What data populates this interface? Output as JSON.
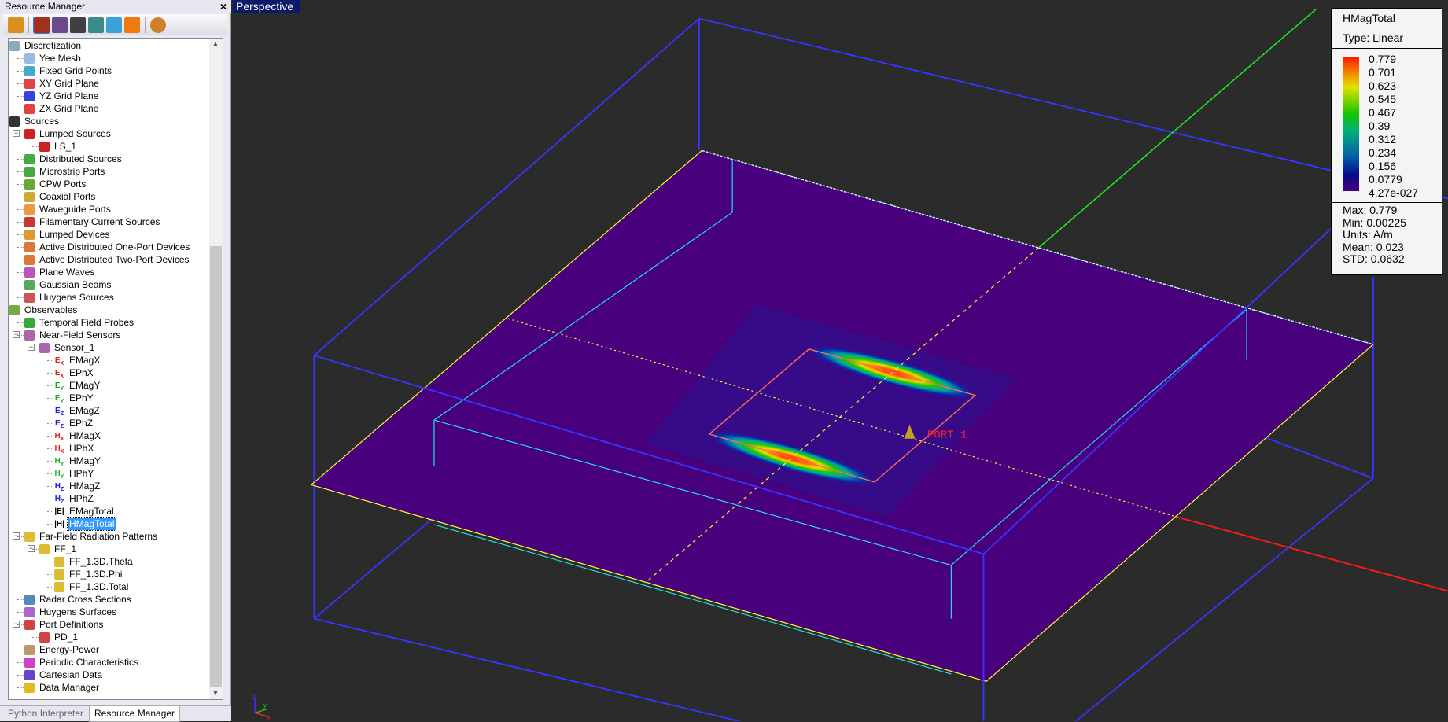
{
  "panel": {
    "title": "Resource Manager",
    "close_glyph": "×",
    "toolbar": [
      {
        "icon": "geometry-icon",
        "color": "#d89020"
      },
      {
        "icon": "materials-icon",
        "color": "#a03020",
        "selected": true
      },
      {
        "icon": "waveform-icon",
        "color": "#6a4a8a"
      },
      {
        "icon": "components-icon",
        "color": "#404040"
      },
      {
        "icon": "mesh-icon",
        "color": "#3a8a8a"
      },
      {
        "icon": "simulation-icon",
        "color": "#3aa0d8"
      },
      {
        "icon": "results-icon",
        "color": "#f07a10"
      },
      {
        "icon": "library-icon",
        "color": "#d0802a"
      }
    ],
    "tree": [
      {
        "label": "Discretization",
        "level": 1,
        "exp": "−",
        "icon": "grid-icon",
        "c": "#8ab"
      },
      {
        "label": "Yee Mesh",
        "level": 2,
        "icon": "yee-mesh-icon",
        "c": "#9bd"
      },
      {
        "label": "Fixed Grid Points",
        "level": 2,
        "icon": "fixed-grid-icon",
        "c": "#4ac"
      },
      {
        "label": "XY Grid Plane",
        "level": 2,
        "icon": "xy-plane-icon",
        "c": "#d44"
      },
      {
        "label": "YZ Grid Plane",
        "level": 2,
        "icon": "yz-plane-icon",
        "c": "#34d"
      },
      {
        "label": "ZX Grid Plane",
        "level": 2,
        "icon": "zx-plane-icon",
        "c": "#d44"
      },
      {
        "label": "Sources",
        "level": 1,
        "exp": "−",
        "icon": "sources-icon",
        "c": "#333"
      },
      {
        "label": "Lumped Sources",
        "level": 2,
        "exp": "−",
        "icon": "lumped-source-icon",
        "c": "#c22"
      },
      {
        "label": "LS_1",
        "level": 3,
        "icon": "lumped-source-icon",
        "c": "#c22"
      },
      {
        "label": "Distributed Sources",
        "level": 2,
        "icon": "distributed-icon",
        "c": "#4a4"
      },
      {
        "label": "Microstrip Ports",
        "level": 2,
        "icon": "microstrip-icon",
        "c": "#4a4"
      },
      {
        "label": "CPW Ports",
        "level": 2,
        "icon": "cpw-icon",
        "c": "#6a3"
      },
      {
        "label": "Coaxial Ports",
        "level": 2,
        "icon": "coax-icon",
        "c": "#ca3"
      },
      {
        "label": "Waveguide Ports",
        "level": 2,
        "icon": "waveguide-icon",
        "c": "#e94"
      },
      {
        "label": "Filamentary Current Sources",
        "level": 2,
        "icon": "filament-icon",
        "c": "#c33"
      },
      {
        "label": "Lumped Devices",
        "level": 2,
        "icon": "lumped-device-icon",
        "c": "#d93"
      },
      {
        "label": "Active Distributed One-Port Devices",
        "level": 2,
        "icon": "one-port-icon",
        "c": "#d73"
      },
      {
        "label": "Active Distributed Two-Port Devices",
        "level": 2,
        "icon": "two-port-icon",
        "c": "#d73"
      },
      {
        "label": "Plane Waves",
        "level": 2,
        "icon": "plane-wave-icon",
        "c": "#b5b"
      },
      {
        "label": "Gaussian Beams",
        "level": 2,
        "icon": "gaussian-icon",
        "c": "#5a5"
      },
      {
        "label": "Huygens Sources",
        "level": 2,
        "icon": "huygens-source-icon",
        "c": "#c55"
      },
      {
        "label": "Observables",
        "level": 1,
        "exp": "−",
        "icon": "observables-icon",
        "c": "#7a4"
      },
      {
        "label": "Temporal Field Probes",
        "level": 2,
        "icon": "probe-icon",
        "c": "#3a3"
      },
      {
        "label": "Near-Field Sensors",
        "level": 2,
        "exp": "−",
        "icon": "sensor-icon",
        "c": "#a6a"
      },
      {
        "label": "Sensor_1",
        "level": 3,
        "exp": "−",
        "icon": "sensor-icon",
        "c": "#a6a"
      },
      {
        "label": "EMagX",
        "level": 4,
        "icon": "ex-icon",
        "glyph": "E",
        "sub": "X",
        "c": "#d22"
      },
      {
        "label": "EPhX",
        "level": 4,
        "icon": "ex-icon",
        "glyph": "E",
        "sub": "X",
        "c": "#d22"
      },
      {
        "label": "EMagY",
        "level": 4,
        "icon": "ey-icon",
        "glyph": "E",
        "sub": "Y",
        "c": "#2a2"
      },
      {
        "label": "EPhY",
        "level": 4,
        "icon": "ey-icon",
        "glyph": "E",
        "sub": "Y",
        "c": "#2a2"
      },
      {
        "label": "EMagZ",
        "level": 4,
        "icon": "ez-icon",
        "glyph": "E",
        "sub": "Z",
        "c": "#22d"
      },
      {
        "label": "EPhZ",
        "level": 4,
        "icon": "ez-icon",
        "glyph": "E",
        "sub": "Z",
        "c": "#22d"
      },
      {
        "label": "HMagX",
        "level": 4,
        "icon": "hx-icon",
        "glyph": "H",
        "sub": "X",
        "c": "#d22"
      },
      {
        "label": "HPhX",
        "level": 4,
        "icon": "hx-icon",
        "glyph": "H",
        "sub": "X",
        "c": "#d22"
      },
      {
        "label": "HMagY",
        "level": 4,
        "icon": "hy-icon",
        "glyph": "H",
        "sub": "Y",
        "c": "#2a2"
      },
      {
        "label": "HPhY",
        "level": 4,
        "icon": "hy-icon",
        "glyph": "H",
        "sub": "Y",
        "c": "#2a2"
      },
      {
        "label": "HMagZ",
        "level": 4,
        "icon": "hz-icon",
        "glyph": "H",
        "sub": "Z",
        "c": "#22d"
      },
      {
        "label": "HPhZ",
        "level": 4,
        "icon": "hz-icon",
        "glyph": "H",
        "sub": "Z",
        "c": "#22d"
      },
      {
        "label": "EMagTotal",
        "level": 4,
        "icon": "e-total-icon",
        "glyph": "|E|",
        "c": "#000"
      },
      {
        "label": "HMagTotal",
        "level": 4,
        "icon": "h-total-icon",
        "glyph": "|H|",
        "c": "#000",
        "selected": true
      },
      {
        "label": "Far-Field Radiation Patterns",
        "level": 2,
        "exp": "−",
        "icon": "far-field-icon",
        "c": "#db3"
      },
      {
        "label": "FF_1",
        "level": 3,
        "exp": "−",
        "icon": "far-field-icon",
        "c": "#db3"
      },
      {
        "label": "FF_1.3D.Theta",
        "level": 4,
        "icon": "far-field-icon",
        "c": "#db3"
      },
      {
        "label": "FF_1.3D.Phi",
        "level": 4,
        "icon": "far-field-icon",
        "c": "#db3"
      },
      {
        "label": "FF_1.3D.Total",
        "level": 4,
        "icon": "far-field-icon",
        "c": "#db3"
      },
      {
        "label": "Radar Cross Sections",
        "level": 2,
        "icon": "rcs-icon",
        "c": "#58b"
      },
      {
        "label": "Huygens Surfaces",
        "level": 2,
        "icon": "huygens-surface-icon",
        "c": "#a6c"
      },
      {
        "label": "Port Definitions",
        "level": 2,
        "exp": "−",
        "icon": "port-def-icon",
        "c": "#c44"
      },
      {
        "label": "PD_1",
        "level": 3,
        "icon": "port-def-icon",
        "c": "#c44"
      },
      {
        "label": "Energy-Power",
        "level": 2,
        "icon": "energy-icon",
        "c": "#b96"
      },
      {
        "label": "Periodic Characteristics",
        "level": 2,
        "icon": "periodic-icon",
        "c": "#c4c"
      },
      {
        "label": "Cartesian Data",
        "level": 2,
        "icon": "cartesian-icon",
        "c": "#64c"
      },
      {
        "label": "Data Manager",
        "level": 2,
        "icon": "data-manager-icon",
        "c": "#db2"
      }
    ]
  },
  "tabs": {
    "python": "Python Interpreter",
    "resource": "Resource Manager"
  },
  "viewport": {
    "label": "Perspective",
    "port_label": "PORT 1",
    "axis_labels": {
      "x": "x",
      "y": "y",
      "z": "z"
    }
  },
  "legend": {
    "title": "HMagTotal",
    "type": "Type: Linear",
    "ticks": [
      "0.779",
      "0.701",
      "0.623",
      "0.545",
      "0.467",
      "0.39",
      "0.312",
      "0.234",
      "0.156",
      "0.0779",
      "4.27e-027"
    ],
    "stats": [
      "Max: 0.779",
      "Min: 0.00225",
      "Units: A/m",
      "Mean: 0.023",
      "STD: 0.0632"
    ]
  },
  "colors": {
    "plane": "#48007c",
    "box": "#3535ff",
    "sensor": "#20e0e8",
    "edge": "#ffff30",
    "port": "#ff6a5a"
  }
}
